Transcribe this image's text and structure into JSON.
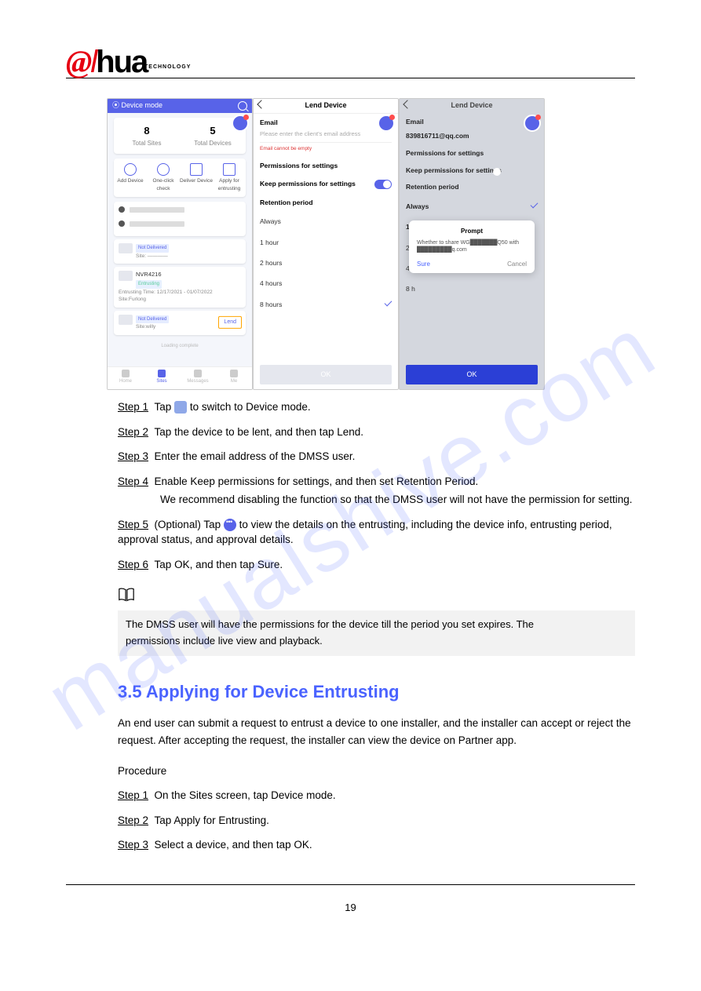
{
  "logo": {
    "brand": "alhua",
    "sub": "TECHNOLOGY"
  },
  "watermark": "manualshive.com",
  "page_number": "19",
  "screenshots": {
    "phone1": {
      "header_title": "Device mode",
      "stats": [
        {
          "value": "8",
          "label": "Total Sites"
        },
        {
          "value": "5",
          "label": "Total Devices"
        }
      ],
      "actions": [
        "Add Device",
        "One-click check",
        "Deliver Device",
        "Apply for entrusting"
      ],
      "device1": {
        "tag": "Not Delivered",
        "site": "Site: ————"
      },
      "device2": {
        "title": "NVR4216",
        "tag": "Entrusting",
        "time": "Entrusting Time: 12/17/2021 - 01/07/2022",
        "site": "Site:Furlong"
      },
      "device3": {
        "tag": "Not Delivered",
        "site": "Site:willy",
        "button": "Lend"
      },
      "loading": "Loading complete",
      "tabs": [
        "Home",
        "Sites",
        "Messages",
        "Me"
      ],
      "active_tab_index": 1
    },
    "phone2": {
      "title": "Lend Device",
      "email_label": "Email",
      "email_placeholder": "Please enter the client's email address",
      "email_error": "Email cannot be empty",
      "section_perm": "Permissions for settings",
      "keep_perm_label": "Keep permissions for settings",
      "section_ret": "Retention period",
      "options": [
        "Always",
        "1 hour",
        "2 hours",
        "4 hours",
        "8 hours"
      ],
      "selected_option": "8 hours",
      "ok": "OK"
    },
    "phone3": {
      "title": "Lend Device",
      "email_label": "Email",
      "email_value": "839816711@qq.com",
      "section_perm": "Permissions for settings",
      "keep_perm_label": "Keep permissions for settings",
      "section_ret": "Retention period",
      "options": [
        "Always",
        "1 hour",
        "2 hours",
        "4 hours",
        "8 hours"
      ],
      "selected_option": "Always",
      "dialog": {
        "title": "Prompt",
        "body_line1": "Whether to share WG███████Q50 with",
        "body_line2": "█████████q.com",
        "sure": "Sure",
        "cancel": "Cancel"
      },
      "ok": "OK"
    },
    "after_step1": "to switch to Device mode."
  },
  "steps": {
    "s1": {
      "num": "Step 1",
      "text_a": "Tap ",
      "text_b": " to switch to Device mode."
    },
    "s2": {
      "num": "Step 2",
      "text": "Tap the device to be lent, and then tap Lend."
    },
    "s3": {
      "num": "Step 3",
      "text": "Enter the email address of the DMSS user."
    },
    "s4": {
      "num": "Step 4",
      "text": "Enable Keep permissions for settings, and then set Retention Period.",
      "sub": "We recommend disabling the function so that the DMSS user will not have the permission for setting."
    },
    "s5": {
      "num": "Step 5",
      "text_a": "(Optional) Tap ",
      "text_b": " to view the details on the entrusting, including the device info, entrusting period, approval status, and approval details."
    },
    "s6": {
      "num": "Step 6",
      "text": "Tap OK, and then tap Sure."
    }
  },
  "note": {
    "line1": "The DMSS user will have the permissions for the device till the period you set expires. The",
    "line2": "permissions include live view and playback."
  },
  "section35": {
    "heading": "3.5 Applying for Device Entrusting",
    "para": "An end user can submit a request to entrust a device to one installer, and the installer can accept or reject the request. After accepting the request, the installer can view the device on Partner app."
  },
  "procedure": {
    "label": "Procedure",
    "s1": {
      "num": "Step 1",
      "text": "On the Sites screen, tap Device mode."
    },
    "s2": {
      "num": "Step 2",
      "text": "Tap Apply for Entrusting."
    },
    "s3": {
      "num": "Step 3",
      "text": "Select a device, and then tap OK."
    }
  }
}
